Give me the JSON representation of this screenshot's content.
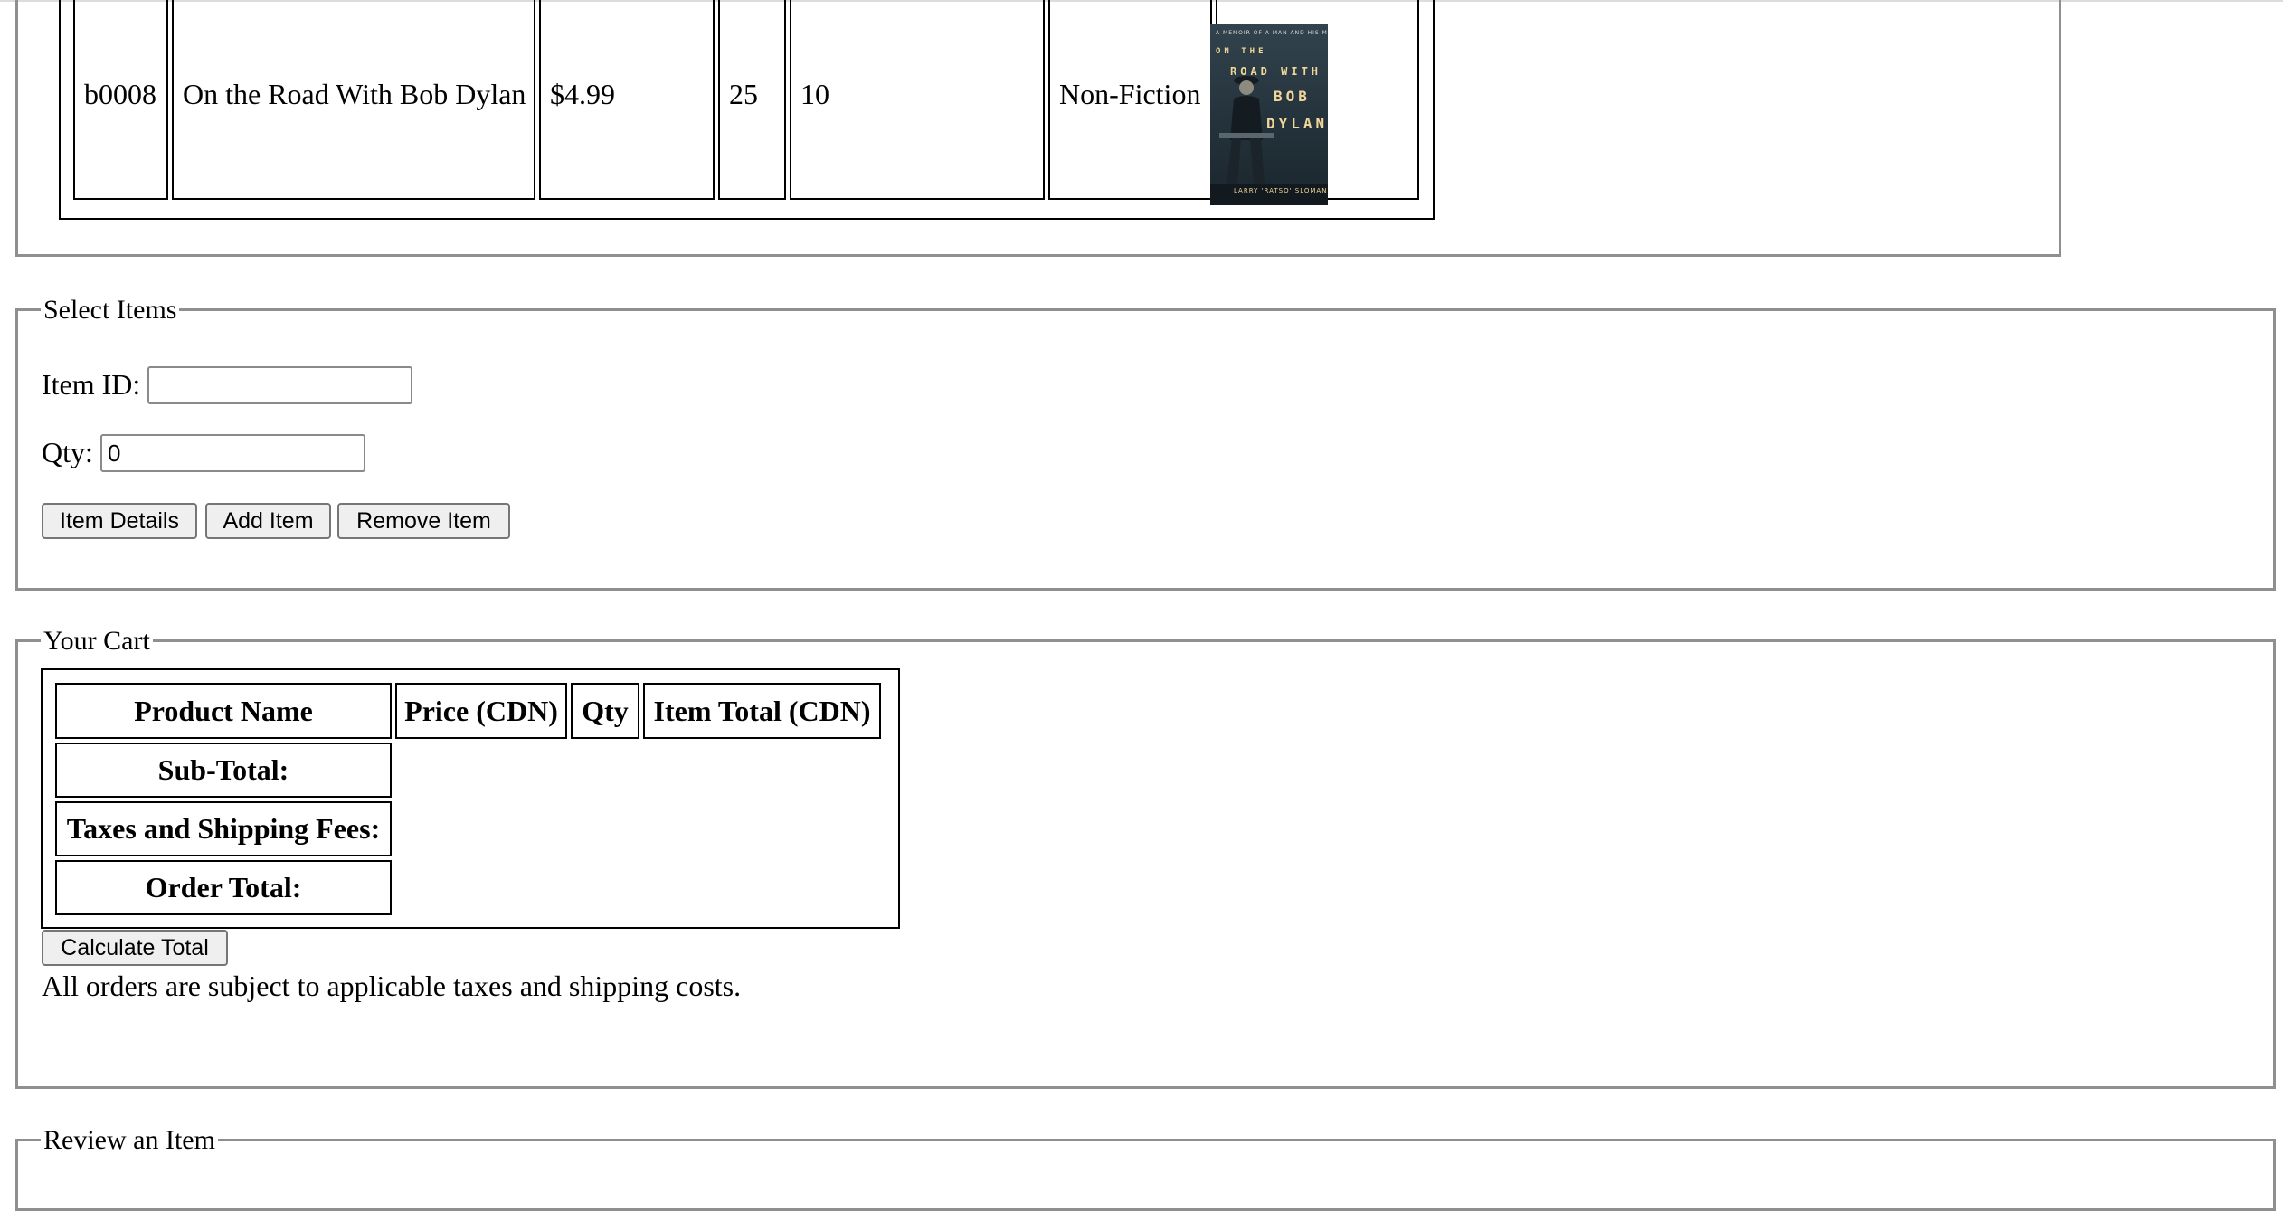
{
  "inventory": {
    "row": {
      "id": "b0008",
      "title": "On the Road With Bob Dylan",
      "price": "$4.99",
      "stock": "25",
      "col5": "10",
      "category": "Non-Fiction",
      "cover": {
        "line1": "ON THE",
        "line2": "ROAD WITH",
        "line3": "BOB",
        "line4": "DYLAN",
        "author": "LARRY 'RATSO' SLOMAN"
      }
    }
  },
  "select_items": {
    "legend": "Select Items",
    "item_id_label": "Item ID:",
    "item_id_value": "",
    "qty_label": "Qty:",
    "qty_value": "0",
    "buttons": {
      "details": "Item Details",
      "add": "Add Item",
      "remove": "Remove Item"
    }
  },
  "cart": {
    "legend": "Your Cart",
    "headers": [
      "Product Name",
      "Price (CDN)",
      "Qty",
      "Item Total (CDN)"
    ],
    "subtotal_label": "Sub-Total:",
    "taxes_label": "Taxes and Shipping Fees:",
    "total_label": "Order Total:",
    "calculate_button": "Calculate Total",
    "note": "All orders are subject to applicable taxes and shipping costs."
  },
  "review": {
    "legend": "Review an Item"
  }
}
